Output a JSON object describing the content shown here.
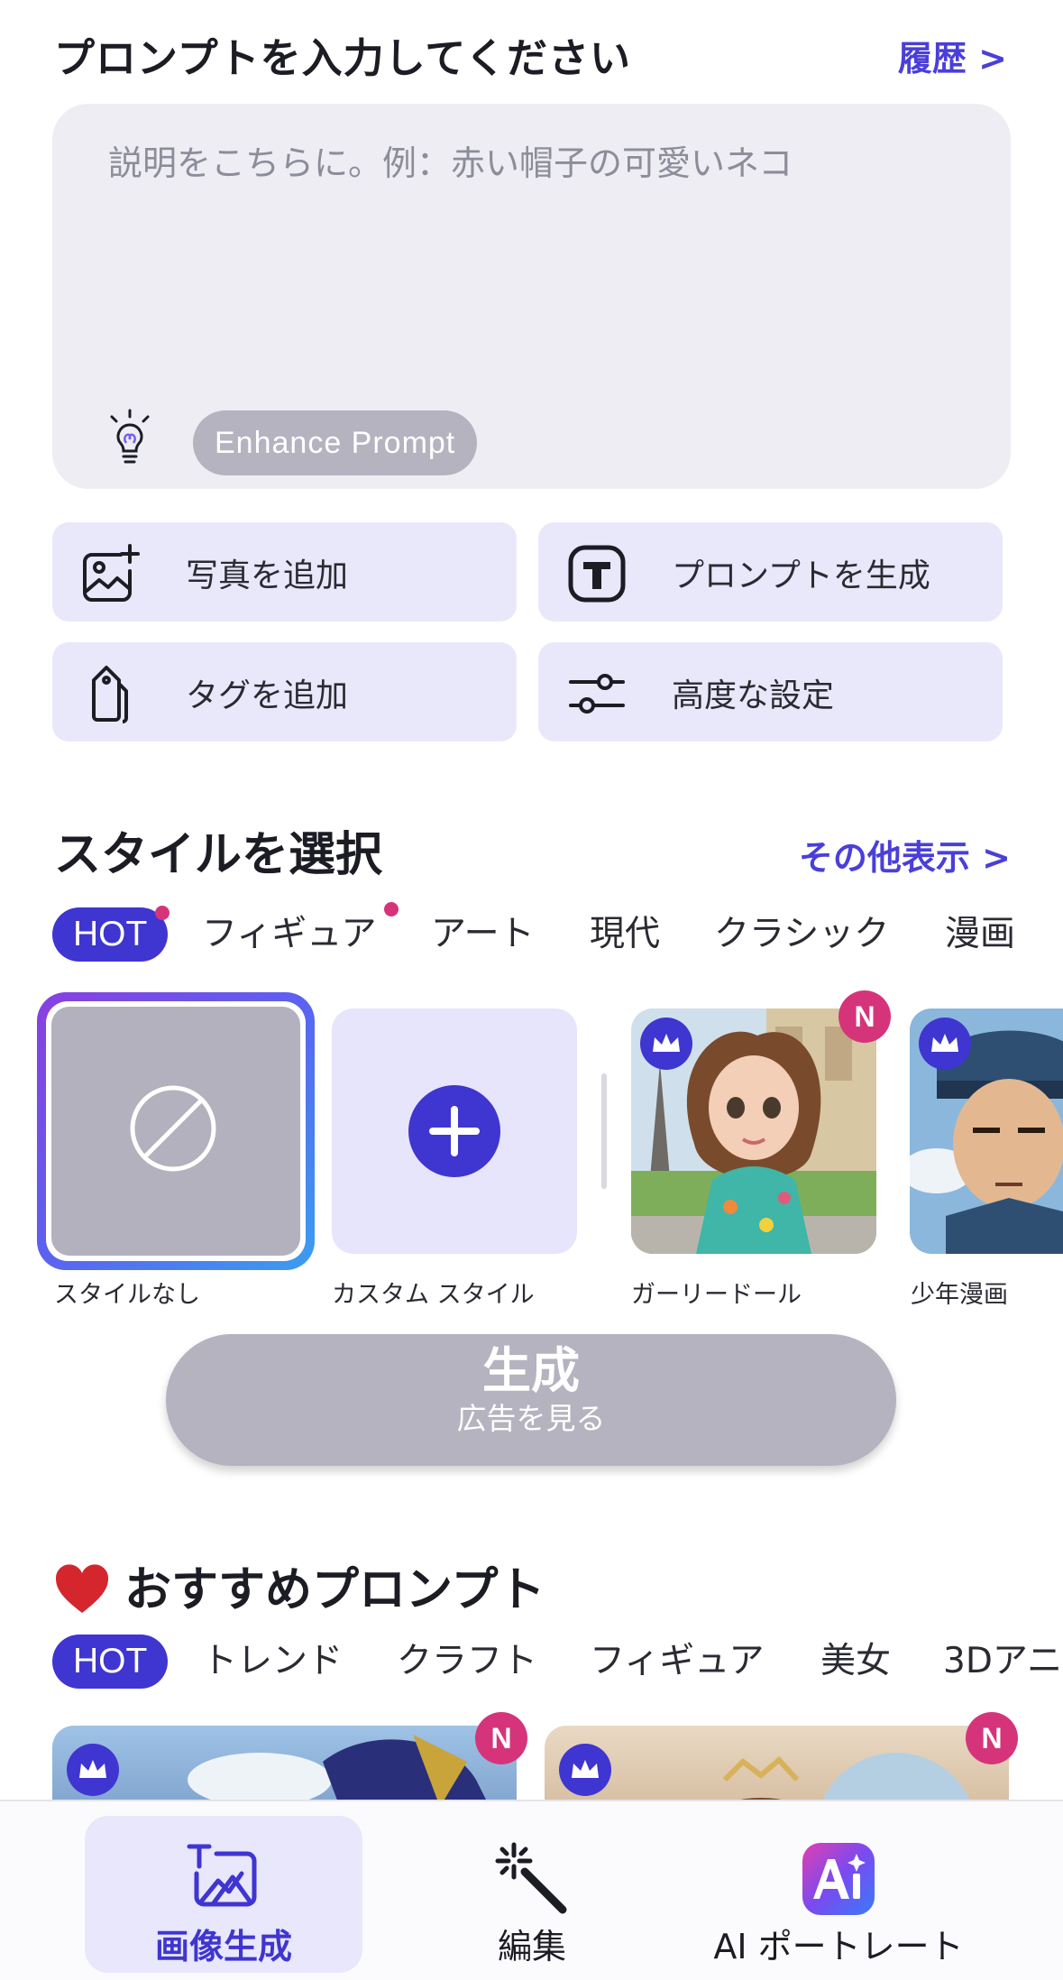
{
  "header": {
    "title": "プロンプトを入力してください",
    "history_link": "履歴 >"
  },
  "prompt": {
    "placeholder": "説明をこちらに。例：赤い帽子の可愛いネコ",
    "value": "",
    "enhance_label": "Enhance Prompt"
  },
  "actions": [
    {
      "label": "写真を追加",
      "icon": "add-photo-icon"
    },
    {
      "label": "プロンプトを生成",
      "icon": "text-t-icon"
    },
    {
      "label": "タグを追加",
      "icon": "tag-icon"
    },
    {
      "label": "高度な設定",
      "icon": "sliders-icon"
    }
  ],
  "style_section": {
    "title": "スタイルを選択",
    "more_link": "その他表示 >",
    "tabs": [
      {
        "label": "HOT",
        "active": true,
        "dot": true
      },
      {
        "label": "フィギュア",
        "active": false,
        "dot": true
      },
      {
        "label": "アート",
        "active": false
      },
      {
        "label": "現代",
        "active": false
      },
      {
        "label": "クラシック",
        "active": false
      },
      {
        "label": "漫画",
        "active": false
      }
    ],
    "cards": [
      {
        "caption": "スタイルなし",
        "selected": true
      },
      {
        "caption": "カスタム スタイル"
      },
      {
        "caption": "ガーリードール",
        "premium": true,
        "new_badge": "N"
      },
      {
        "caption": "少年漫画",
        "premium": true
      }
    ]
  },
  "generate": {
    "label": "生成",
    "sub_label": "広告を見る"
  },
  "recommend": {
    "title": "おすすめプロンプト",
    "tabs": [
      {
        "label": "HOT",
        "active": true
      },
      {
        "label": "トレンド"
      },
      {
        "label": "クラフト"
      },
      {
        "label": "フィギュア"
      },
      {
        "label": "美女"
      },
      {
        "label": "3Dアニ"
      }
    ],
    "cards": [
      {
        "premium": true,
        "new_badge": "N"
      },
      {
        "premium": true,
        "new_badge": "N"
      }
    ]
  },
  "bottom_nav": [
    {
      "label": "画像生成",
      "icon": "image-generate-icon",
      "active": true
    },
    {
      "label": "編集",
      "icon": "magic-wand-icon",
      "active": false
    },
    {
      "label": "AI ポートレート",
      "icon": "ai-portrait-icon",
      "active": false
    }
  ],
  "colors": {
    "accent": "#3f35d0",
    "badge": "#d6347a",
    "card_bg": "#e9e8fb",
    "disabled": "#b4b3bf"
  }
}
